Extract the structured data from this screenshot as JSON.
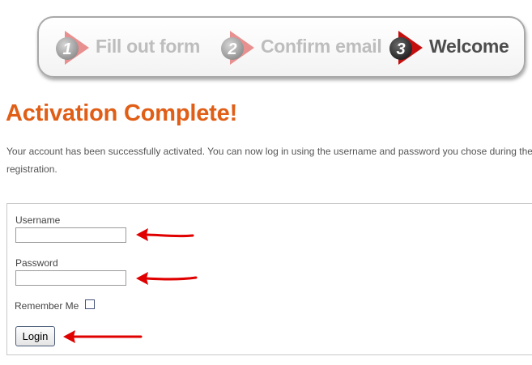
{
  "steps": [
    {
      "number": "1",
      "label": "Fill out form",
      "state": "inactive"
    },
    {
      "number": "2",
      "label": "Confirm email",
      "state": "inactive"
    },
    {
      "number": "3",
      "label": "Welcome",
      "state": "active"
    }
  ],
  "page": {
    "title": "Activation Complete!",
    "intro": "Your account has been successfully activated. You can now log in using the username and password you chose during the registration."
  },
  "login": {
    "username_label": "Username",
    "username_value": "",
    "password_label": "Password",
    "password_value": "",
    "remember_label": "Remember Me",
    "remember_checked": false,
    "button_label": "Login"
  },
  "colors": {
    "title": "#e05e16",
    "step_active_arrow": "#c50f0f",
    "step_inactive_arrow": "#e89090",
    "annotation_arrow": "#e00000"
  }
}
